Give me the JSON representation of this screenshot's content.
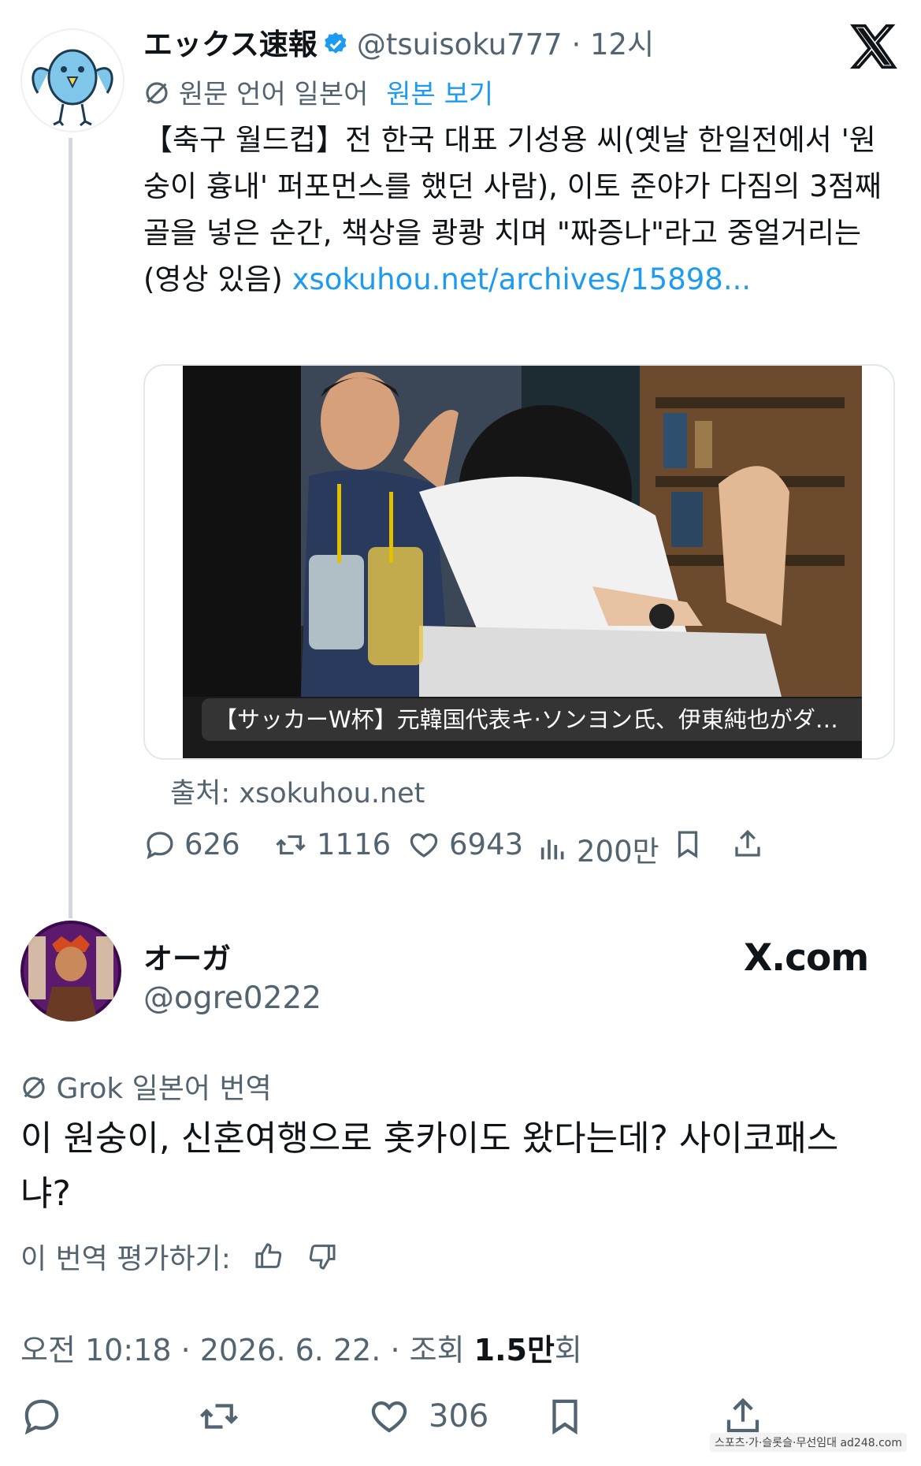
{
  "tweet": {
    "author_name": "エックス速報",
    "handle": "@tsuisoku777",
    "time": "12시",
    "separator": " · ",
    "translation_label": "원문 언어 일본어",
    "view_original": "원본 보기",
    "text": "【축구 월드컵】전 한국 대표 기성용 씨(옛날 한일전에서 '원숭이 흉내' 퍼포먼스를 했던 사람), 이토 준야가 다짐의 3점째 골을 넣은 순간, 책상을 쾅쾅 치며 \"짜증나\"라고 중얼거리는(영상 있음) ",
    "link": "xsokuhou.net/archives/15898...",
    "card_caption": "【サッカーW杯】元韓国代表キ·ソンヨン氏、伊東純也がダ…",
    "source": "출처: xsokuhou.net",
    "metrics": {
      "replies": "626",
      "retweets": "1116",
      "likes": "6943",
      "views": "200만"
    }
  },
  "reply": {
    "author_name": "オーガ",
    "handle": "@ogre0222",
    "site_logo": "X.com",
    "grok_label": "Grok 일본어 번역",
    "text": "이 원숭이, 신혼여행으로 홋카이도 왔다는데? 사이코패스냐?",
    "rate_label": "이 번역 평가하기:",
    "timestamp_prefix": "오전 10:18 · 2026. 6. 22. · 조회 ",
    "views_bold": "1.5만",
    "views_suffix": "회",
    "likes": "306"
  },
  "watermark": "스포츠·가·슬롯슬·무선임대 ad248.com",
  "colors": {
    "accent": "#1d9bf0",
    "muted": "#536471",
    "text": "#0f1419"
  },
  "icons": [
    "verified-icon",
    "x-logo-icon",
    "translate-icon",
    "reply-icon",
    "retweet-icon",
    "like-icon",
    "views-icon",
    "bookmark-icon",
    "share-icon",
    "thumbs-up-icon",
    "thumbs-down-icon"
  ]
}
